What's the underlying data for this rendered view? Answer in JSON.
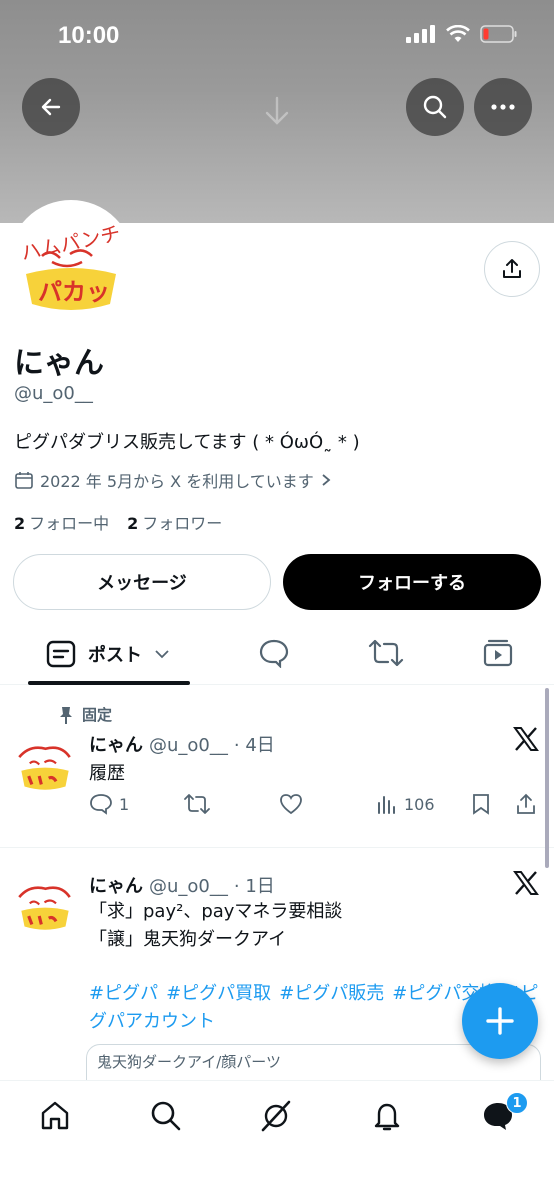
{
  "status_bar": {
    "time": "10:00"
  },
  "profile": {
    "name": "にゃん",
    "handle": "@u_o0__",
    "bio": "ピグパダブリス販売してます ( * ÓωÓ˷ * )",
    "joined": "2022 年 5月から X を利用しています",
    "following_count": "2",
    "following_label": "フォロー中",
    "followers_count": "2",
    "followers_label": "フォロワー",
    "message_button": "メッセージ",
    "follow_button": "フォローする"
  },
  "tabs": {
    "posts_label": "ポスト"
  },
  "posts": [
    {
      "pinned_label": "固定",
      "name": "にゃん",
      "handle": "@u_o0__",
      "time": "· 4日",
      "text": "履歴",
      "replies": "1",
      "views": "106"
    },
    {
      "name": "にゃん",
      "handle": "@u_o0__",
      "time": "· 1日",
      "text_line1": "「求」pay²、payマネラ要相談",
      "text_line2": "「譲」鬼天狗ダークアイ",
      "hashtags": [
        "#ピグパ",
        "#ピグパ買取",
        "#ピグパ販売",
        "#ピグパ交換",
        "#ピグパアカウント"
      ],
      "card_title": "鬼天狗ダークアイ/顔パーツ"
    }
  ],
  "avatar_text": {
    "top": "ハムパンチ",
    "bottom": "パカッ"
  },
  "nav": {
    "messages_badge": "1"
  },
  "colors": {
    "accent": "#1d9bf0",
    "text": "#0f1419",
    "secondary": "#536471"
  }
}
